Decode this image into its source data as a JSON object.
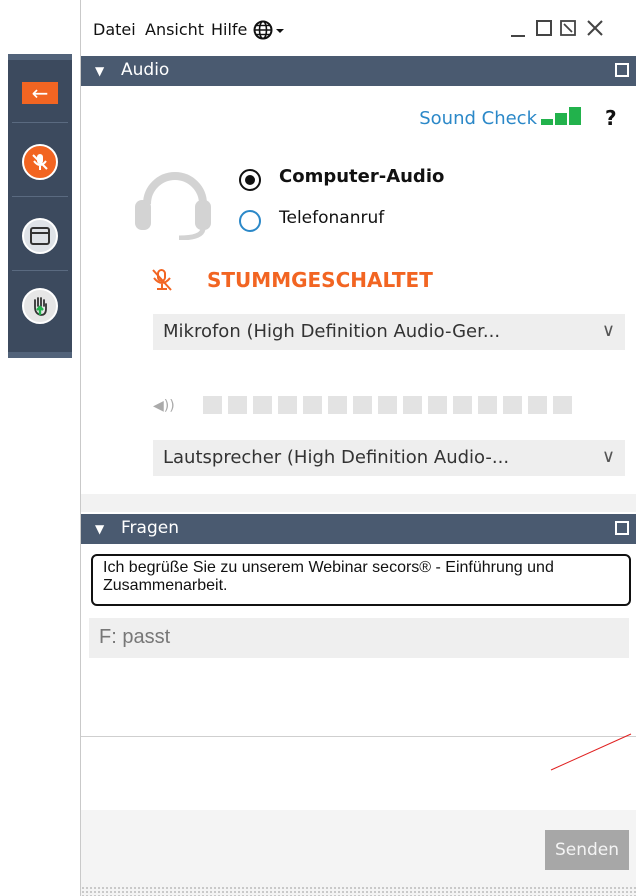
{
  "menubar": {
    "items": [
      "Datei",
      "Ansicht",
      "Hilfe"
    ],
    "language_icon": "globe-icon"
  },
  "audio": {
    "header": "Audio",
    "sound_check": "Sound Check",
    "help": "?",
    "options": [
      {
        "label": "Computer-Audio",
        "selected": true
      },
      {
        "label": "Telefonanruf",
        "selected": false
      }
    ],
    "mute_status": "STUMMGESCHALTET",
    "microphone": "Mikrofon (High Definition Audio-Ger...",
    "speaker": "Lautsprecher (High Definition Audio-...",
    "speaker_level": 0
  },
  "fragen": {
    "header": "Fragen",
    "message": "Ich begrüße Sie zu unserem Webinar secors® - Einführung und Zusammenarbeit.",
    "question": "F: passt",
    "send_label": "Senden"
  },
  "colors": {
    "accent": "#f26522",
    "header_bg": "#4a5a70",
    "link": "#2b88c8",
    "signal": "#22b24c"
  }
}
